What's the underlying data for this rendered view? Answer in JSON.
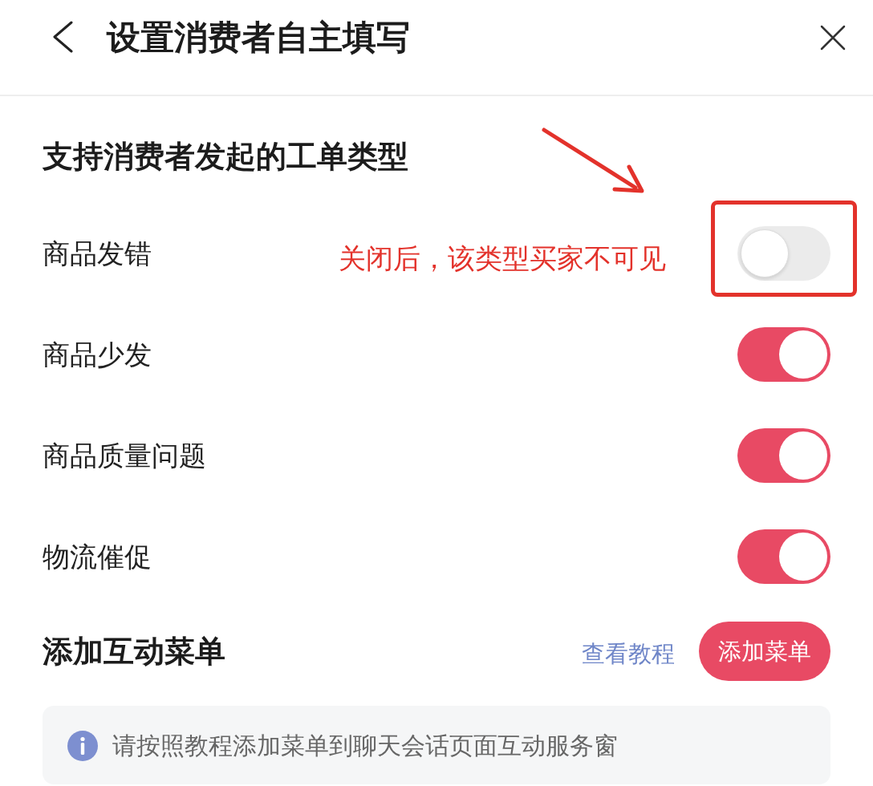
{
  "header": {
    "title": "设置消费者自主填写"
  },
  "ticket_types": {
    "title": "支持消费者发起的工单类型",
    "items": [
      {
        "label": "商品发错",
        "on": false
      },
      {
        "label": "商品少发",
        "on": true
      },
      {
        "label": "商品质量问题",
        "on": true
      },
      {
        "label": "物流催促",
        "on": true
      }
    ]
  },
  "annotation": {
    "text": "关闭后，该类型买家不可见"
  },
  "menu_section": {
    "title": "添加互动菜单",
    "link": "查看教程",
    "button": "添加菜单",
    "notice": "请按照教程添加菜单到聊天会话页面互动服务窗"
  }
}
